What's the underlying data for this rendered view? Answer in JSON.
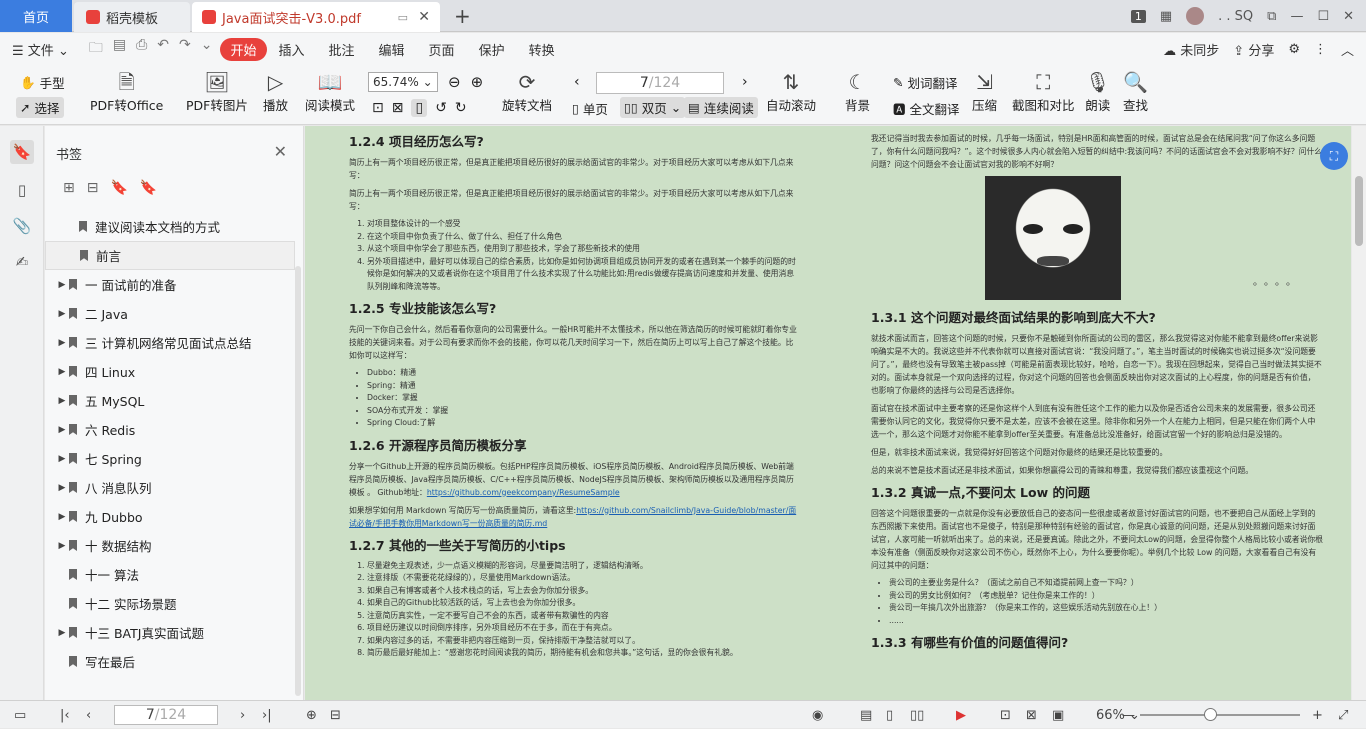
{
  "tabs": {
    "home": "首页",
    "daoke": "稻壳模板",
    "pdf": "Java面试突击-V3.0.pdf"
  },
  "window": {
    "page_badge": "1",
    "user": ". . SQ"
  },
  "menu": {
    "file": "文件",
    "items": [
      "开始",
      "插入",
      "批注",
      "编辑",
      "页面",
      "保护",
      "转换"
    ],
    "right": {
      "sync": "未同步",
      "share": "分享"
    }
  },
  "ribbon": {
    "hand": "手型",
    "select": "选择",
    "pdf_to_office": "PDF转Office",
    "pdf_to_image": "PDF转图片",
    "play": "播放",
    "read_mode": "阅读模式",
    "zoom": "65.74%",
    "rotate": "旋转文档",
    "page_current": "7",
    "page_total": "/124",
    "single": "单页",
    "double": "双页",
    "continuous": "连续阅读",
    "autoscroll": "自动滚动",
    "background": "背景",
    "word_translate": "划词翻译",
    "full_translate": "全文翻译",
    "compress": "压缩",
    "screenshot": "截图和对比",
    "read_aloud": "朗读",
    "find": "查找"
  },
  "bookmarks": {
    "title": "书签",
    "items": [
      {
        "label": "建议阅读本文档的方式",
        "arrow": false
      },
      {
        "label": "前言",
        "arrow": false
      },
      {
        "label": "一  面试前的准备",
        "arrow": true
      },
      {
        "label": "二  Java",
        "arrow": true
      },
      {
        "label": "三   计算机网络常见面试点总结",
        "arrow": true
      },
      {
        "label": "四 Linux",
        "arrow": true
      },
      {
        "label": "五 MySQL",
        "arrow": true
      },
      {
        "label": "六 Redis",
        "arrow": true
      },
      {
        "label": "七 Spring",
        "arrow": true
      },
      {
        "label": "八 消息队列",
        "arrow": true
      },
      {
        "label": "九 Dubbo",
        "arrow": true
      },
      {
        "label": "十 数据结构",
        "arrow": true
      },
      {
        "label": "十一  算法",
        "arrow": false
      },
      {
        "label": "十二  实际场景题",
        "arrow": false
      },
      {
        "label": "十三 BATJ真实面试题",
        "arrow": true
      },
      {
        "label": "写在最后",
        "arrow": false
      }
    ]
  },
  "left_page": {
    "h1": "1.2.4 项目经历怎么写?",
    "p1": "简历上有一两个项目经历很正常，但是真正能把项目经历很好的展示给面试官的非常少。对于项目经历大家可以考虑从如下几点来写：",
    "p2": "简历上有一两个项目经历很正常，但是真正能把项目经历很好的展示给面试官的非常少。对于项目经历大家可以考虑从如下几点来写：",
    "list1": [
      "对项目整体设计的一个感受",
      "在这个项目中你负责了什么、做了什么、担任了什么角色",
      "从这个项目中你学会了那些东西，使用到了那些技术，学会了那些新技术的使用",
      "另外项目描述中，最好可以体现自己的综合素质，比如你是如何协调项目组成员协同开发的或者在遇到某一个棘手的问题的时候你是如何解决的又或者说你在这个项目用了什么技术实现了什么功能比如:用redis做缓存提高访问速度和并发量、使用消息队列削峰和降流等等。"
    ],
    "h2": "1.2.5 专业技能该怎么写?",
    "p3": "先问一下你自己会什么，然后看看你意向的公司需要什么。一般HR可能并不太懂技术，所以他在筛选简历的时候可能就盯着你专业技能的关键词来看。对于公司有要求而你不会的技能，你可以花几天时间学习一下，然后在简历上可以写上自己了解这个技能。比如你可以这样写：",
    "list2": [
      "Dubbo：精通",
      "Spring：精通",
      "Docker：掌握",
      "SOA分布式开发 ：掌握",
      "Spring Cloud:了解"
    ],
    "h3": "1.2.6 开源程序员简历模板分享",
    "p4": "分享一个Github上开源的程序员简历模板。包括PHP程序员简历模板、iOS程序员简历模板、Android程序员简历模板、Web前端程序员简历模板、Java程序员简历模板、C/C++程序员简历模板、NodeJS程序员简历模板、架构师简历模板以及通用程序员简历模板 。 Github地址：",
    "link1": "https://github.com/geekcompany/ResumeSample",
    "p5": "如果想学如何用 Markdown 写简历写一份高质量简历，请看这里:",
    "link2": "https://github.com/Snailclimb/Java-Guide/blob/master/面试必备/手把手教你用Markdown写一份高质量的简历.md",
    "h4": "1.2.7 其他的一些关于写简历的小tips",
    "list3": [
      "尽量避免主观表述，少一点语义模糊的形容词，尽量要简洁明了，逻辑结构清晰。",
      "注意排版（不需要花花绿绿的），尽量使用Markdown语法。",
      "如果自己有博客或者个人技术栈点的话，写上去会为你加分很多。",
      "如果自己的Github比较活跃的话，写上去也会为你加分很多。",
      "注意简历真实性，一定不要写自己不会的东西，或者带有欺骗性的内容",
      "项目经历建议以时间倒序排序，另外项目经历不在于多，而在于有亮点。",
      "如果内容过多的话，不需要非把内容压缩到一页，保持排版干净整洁就可以了。",
      "简历最后最好能加上：“感谢您花时间阅读我的简历，期待能有机会和您共事。”这句话，显的你会很有礼貌。"
    ]
  },
  "right_page": {
    "p1": "我还记得当时我去参加面试的时候，几乎每一场面试，特别是HR面和高管面的时候，面试官总是会在结尾问我“问了你这么多问题了，你有什么问题问我吗？”。这个时候很多人内心就会陷入短暂的纠结中:我该问吗？不问的话面试官会不会对我影响不好？问什么问题？问这个问题会不会让面试官对我的影响不好啊？",
    "meme_dots": "。。。。",
    "h1": "1.3.1 这个问题对最终面试结果的影响到底大不大?",
    "p2": "就技术面试而言，回答这个问题的时候，只要你不是触碰到你所面试的公司的雷区，那么我觉得这对你能不能拿到最终offer来说影响确实是不大的。我说这些并不代表你就可以直接对面试官说：“我没问题了。”，笔主当时面试的时候确实也说过挺多次“没问题要问了。”，最终也没有导致笔主被pass掉（可能是前面表现比较好，哈哈，自恋一下）。我现在回想起来，觉得自己当时做法其实挺不对的。面试本身就是一个双向选择的过程，你对这个问题的回答也会侧面反映出你对这次面试的上心程度，你的问题是否有价值，也影响了你最终的选择与公司是否选择你。",
    "p3": "面试官在技术面试中主要考察的还是你这样个人到底有没有胜任这个工作的能力以及你是否适合公司未来的发展需要，很多公司还需要你认同它的文化，我觉得你只要不是太差，应该不会被在这里。除非你和另外一个人在能力上相同，但是只能在你们两个人中选一个，那么这个问题才对你能不能拿到offer至关重要。有准备总比没准备好，给面试官留一个好的影响总归是没错的。",
    "p4": "但是，就非技术面试来说，我觉得好好回答这个问题对你最终的结果还是比较重要的。",
    "p5": "总的来说不管是技术面试还是非技术面试，如果你想赢得公司的青睐和尊重，我觉得我们都应该重视这个问题。",
    "h2": "1.3.2 真诚一点,不要问太 Low 的问题",
    "p6": "回答这个问题很重要的一点就是你没有必要放低自己的姿态问一些很虚或者故意讨好面试官的问题，也不要把自己从面经上学到的东西照搬下来使用。面试官也不是傻子，特别是那种特别有经验的面试官，你是真心诚意的问问题，还是从别处照搬问题来讨好面试官，人家可能一听就听出来了。总的来说，还是要真诚。除此之外，不要问太Low的问题，会显得你整个人格局比较小或者说你根本没有准备（侧面反映你对这家公司不伤心，既然你不上心，为什么要要你呢）。举例几个比较 Low 的问题，大家看看自己有没有问过其中的问题：",
    "list1": [
      "贵公司的主要业务是什么？（面试之前自己不知道提前网上查一下吗？）",
      "贵公司的男女比例如何？（考虑脱单？记住你是来工作的！）",
      "贵公司一年搞几次外出旅游？（你是来工作的，这些娱乐活动先别放在心上！）",
      "......"
    ],
    "h3": "1.3.3 有哪些有价值的问题值得问?"
  },
  "statusbar": {
    "page_current": "7",
    "page_total": "/124",
    "zoom": "66%"
  }
}
